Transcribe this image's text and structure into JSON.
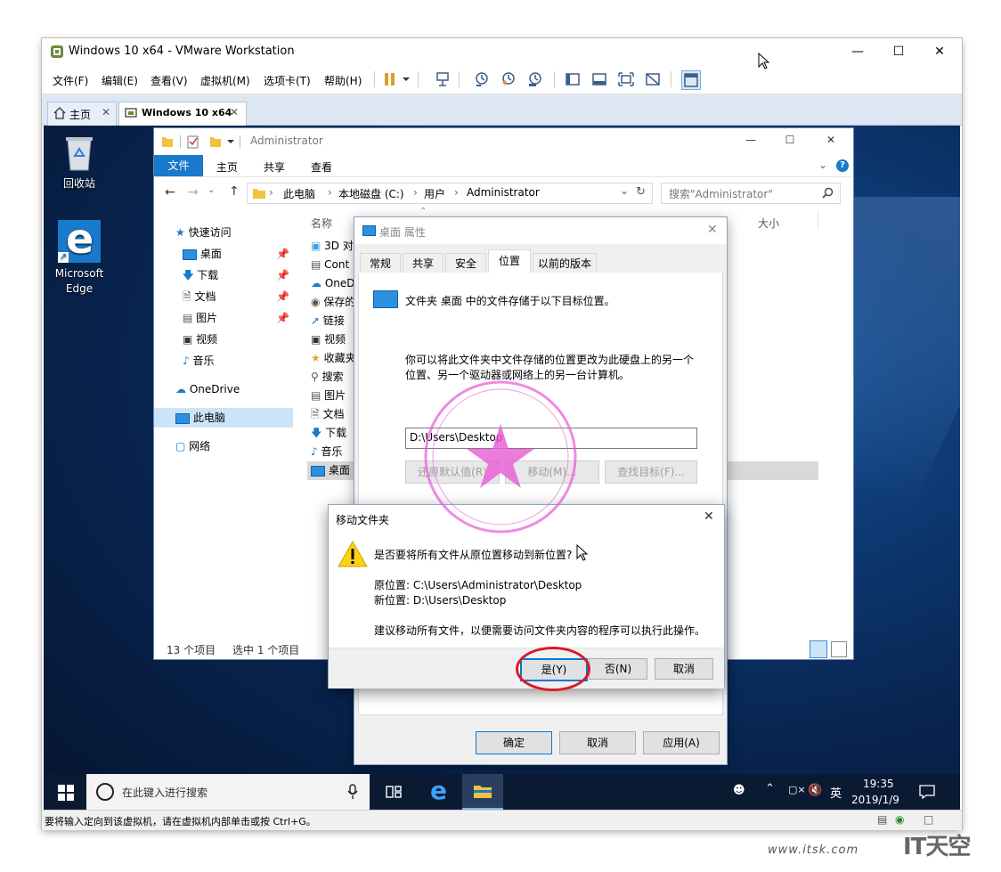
{
  "vmware": {
    "title": "Windows 10 x64 - VMware Workstation",
    "menu": [
      "文件(F)",
      "编辑(E)",
      "查看(V)",
      "虚拟机(M)",
      "选项卡(T)",
      "帮助(H)"
    ],
    "tabs": [
      {
        "label": "主页"
      },
      {
        "label": "Windows 10 x64"
      }
    ],
    "status_text": "要将输入定向到该虚拟机，请在虚拟机内部单击或按 Ctrl+G。"
  },
  "desktop": {
    "icons": [
      {
        "label": "回收站"
      },
      {
        "label": "Microsoft Edge"
      }
    ]
  },
  "explorer": {
    "title": "Administrator",
    "ribbon_tabs": [
      "文件",
      "主页",
      "共享",
      "查看"
    ],
    "breadcrumb": [
      "此电脑",
      "本地磁盘 (C:)",
      "用户",
      "Administrator"
    ],
    "search_placeholder": "搜索\"Administrator\"",
    "col_name": "名称",
    "col_size": "大小",
    "nav": [
      "快速访问",
      "桌面",
      "下载",
      "文档",
      "图片",
      "视频",
      "音乐",
      "OneDrive",
      "此电脑",
      "网络"
    ],
    "files": [
      "3D 对",
      "Cont",
      "OneD",
      "保存的",
      "链接",
      "视频",
      "收藏夹",
      "搜索",
      "图片",
      "文档",
      "下载",
      "音乐",
      "桌面"
    ],
    "status_count": "13 个项目",
    "status_selected": "选中 1 个项目"
  },
  "props": {
    "title": "桌面 属性",
    "tabs": [
      "常规",
      "共享",
      "安全",
      "位置",
      "以前的版本"
    ],
    "active_tab": "位置",
    "info": "文件夹 桌面 中的文件存储于以下目标位置。",
    "desc_line1": "你可以将此文件夹中文件存储的位置更改为此硬盘上的另一个",
    "desc_line2": "位置、另一个驱动器或网络上的另一台计算机。",
    "path_value": "D:\\Users\\Desktop",
    "btn_restore": "还原默认值(R)",
    "btn_move": "移动(M)...",
    "btn_find": "查找目标(F)...",
    "btn_ok": "确定",
    "btn_cancel": "取消",
    "btn_apply": "应用(A)"
  },
  "move_dialog": {
    "title": "移动文件夹",
    "question": "是否要将所有文件从原位置移动到新位置?",
    "origin": "原位置: C:\\Users\\Administrator\\Desktop",
    "new_location": "新位置: D:\\Users\\Desktop",
    "advice": "建议移动所有文件，以便需要访问文件夹内容的程序可以执行此操作。",
    "btn_yes": "是(Y)",
    "btn_no": "否(N)",
    "btn_cancel": "取消"
  },
  "taskbar": {
    "search_placeholder": "在此键入进行搜索",
    "ime": "英",
    "time": "19:35",
    "date": "2019/1/9"
  },
  "watermark": {
    "site": "www.itsk.com",
    "brand": "IT天空"
  },
  "colors": {
    "accent": "#1979ca",
    "annotation": "#d91a2a",
    "stamp": "#e75ad6"
  }
}
